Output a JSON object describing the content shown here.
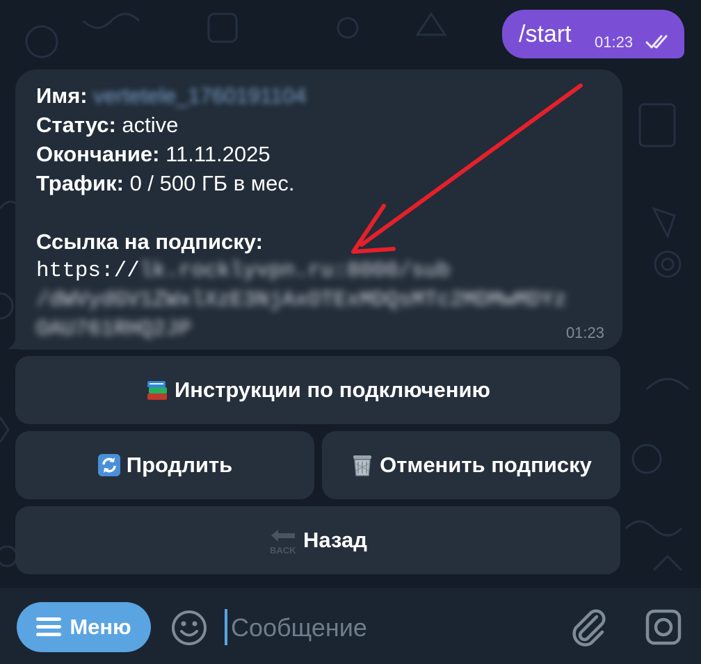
{
  "colors": {
    "accent": "#5aa4e2",
    "outgoing_bubble": "#7a4fd6",
    "incoming_bubble": "#222d39",
    "arrow": "#e5202a"
  },
  "outgoing": {
    "text": "/start",
    "time": "01:23"
  },
  "incoming": {
    "name_label": "Имя:",
    "name_value": "vertetele_1760191104",
    "status_label": "Статус:",
    "status_value": " active",
    "expiry_label": "Окончание:",
    "expiry_value": " 11.11.2025",
    "traffic_label": "Трафик:",
    "traffic_value": " 0 / 500 ГБ в мес.",
    "link_label": "Ссылка на подписку:",
    "link_prefix": "https://",
    "link_rest_1": "lk.rocklyvpn.ru:8000/sub",
    "link_rest_2": "/dWVydGV1ZWxlXzE3NjAxOTExMDQsMTc2MDMwMDYz",
    "link_rest_3": "OAU761RHQ2JP",
    "time": "01:23"
  },
  "keyboard": {
    "instructions": "Инструкции по подключению",
    "renew": "Продлить",
    "cancel": "Отменить подписку",
    "back": "Назад",
    "back_icon_text": "BACK"
  },
  "bottom": {
    "menu_label": "Меню",
    "input_placeholder": "Сообщение"
  },
  "icons": [
    "books-icon",
    "refresh-icon",
    "trash-icon",
    "back-arrow-icon",
    "hamburger-icon",
    "smile-icon",
    "paperclip-icon",
    "camera-icon",
    "double-check-icon"
  ]
}
